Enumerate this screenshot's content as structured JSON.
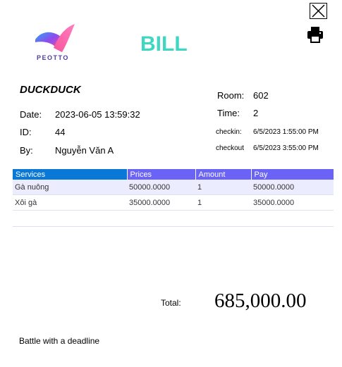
{
  "window": {
    "close_icon": "close-icon",
    "print_icon": "printer-icon"
  },
  "logo": {
    "text": "PEOTTO"
  },
  "title": "BILL",
  "company": "DUCKDUCK",
  "info": {
    "date_label": "Date:",
    "date_value": "2023-06-05 13:59:32",
    "id_label": "ID:",
    "id_value": "44",
    "by_label": "By:",
    "by_value": "Nguyễn Văn A",
    "room_label": "Room:",
    "room_value": "602",
    "time_label": "Time:",
    "time_value": "2",
    "checkin_label": "checkin:",
    "checkin_value": "6/5/2023 1:55:00 PM",
    "checkout_label": "checkout",
    "checkout_value": "6/5/2023 3:55:00 PM"
  },
  "table": {
    "headers": [
      "Services",
      "Prices",
      "Amount",
      "Pay"
    ],
    "rows": [
      [
        "Gà nuông",
        "50000.0000",
        "1",
        "50000.0000"
      ],
      [
        "Xôi gà",
        "35000.0000",
        "1",
        "35000.0000"
      ]
    ]
  },
  "total": {
    "label": "Total:",
    "value": "685,000.00"
  },
  "footer": "Battle with a deadline",
  "colors": {
    "title": "#3fd6c4",
    "header_first": "#0a78d7",
    "header_other": "#6b63f6",
    "row_alt": "#ececff"
  }
}
